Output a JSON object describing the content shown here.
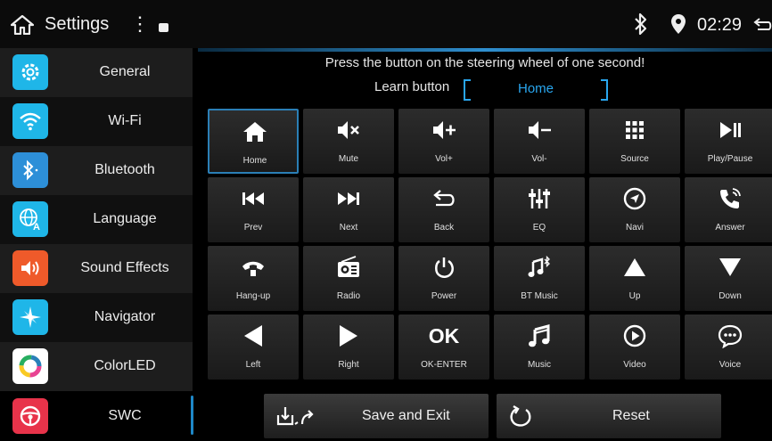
{
  "status_bar": {
    "title": "Settings",
    "time": "02:29"
  },
  "sidebar": {
    "items": [
      {
        "label": "General",
        "icon": "gear-icon",
        "color": "#1fb6e8"
      },
      {
        "label": "Wi-Fi",
        "icon": "wifi-icon",
        "color": "#1fb6e8"
      },
      {
        "label": "Bluetooth",
        "icon": "bluetooth-icon",
        "color": "#2d8fd8"
      },
      {
        "label": "Language",
        "icon": "globe-icon",
        "color": "#1fb6e8"
      },
      {
        "label": "Sound Effects",
        "icon": "speaker-icon",
        "color": "#ef5a2a"
      },
      {
        "label": "Navigator",
        "icon": "compass-icon",
        "color": "#1fb6e8"
      },
      {
        "label": "ColorLED",
        "icon": "color-wheel-icon",
        "color": "#ffffff"
      },
      {
        "label": "SWC",
        "icon": "steering-wheel-icon",
        "color": "#e8334a"
      }
    ]
  },
  "main": {
    "instruction": "Press the button on the steering wheel of one second!",
    "learn_label": "Learn button",
    "learn_value": "Home",
    "buttons": [
      {
        "label": "Home",
        "icon": "home-icon"
      },
      {
        "label": "Mute",
        "icon": "mute-icon"
      },
      {
        "label": "Vol+",
        "icon": "volume-up-icon"
      },
      {
        "label": "Vol-",
        "icon": "volume-down-icon"
      },
      {
        "label": "Source",
        "icon": "grid-icon"
      },
      {
        "label": "Play/Pause",
        "icon": "play-pause-icon"
      },
      {
        "label": "Prev",
        "icon": "previous-icon"
      },
      {
        "label": "Next",
        "icon": "next-icon"
      },
      {
        "label": "Back",
        "icon": "back-arrow-icon"
      },
      {
        "label": "EQ",
        "icon": "equalizer-icon"
      },
      {
        "label": "Navi",
        "icon": "navigation-icon"
      },
      {
        "label": "Answer",
        "icon": "phone-answer-icon"
      },
      {
        "label": "Hang-up",
        "icon": "phone-hangup-icon"
      },
      {
        "label": "Radio",
        "icon": "radio-icon"
      },
      {
        "label": "Power",
        "icon": "power-icon"
      },
      {
        "label": "BT Music",
        "icon": "bt-music-icon"
      },
      {
        "label": "Up",
        "icon": "triangle-up-icon"
      },
      {
        "label": "Down",
        "icon": "triangle-down-icon"
      },
      {
        "label": "Left",
        "icon": "triangle-left-icon"
      },
      {
        "label": "Right",
        "icon": "triangle-right-icon"
      },
      {
        "label": "OK-ENTER",
        "icon": "ok-icon",
        "icon_text": "OK"
      },
      {
        "label": "Music",
        "icon": "music-icon"
      },
      {
        "label": "Video",
        "icon": "video-play-icon"
      },
      {
        "label": "Voice",
        "icon": "voice-bubble-icon"
      }
    ],
    "save_label": "Save and Exit",
    "reset_label": "Reset"
  },
  "colors": {
    "accent": "#29a6ee",
    "background": "#000000"
  }
}
